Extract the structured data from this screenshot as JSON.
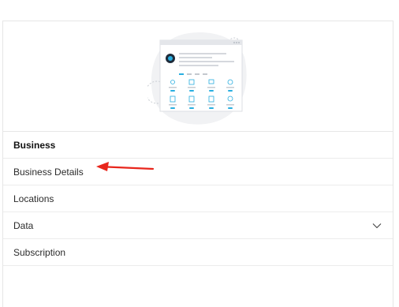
{
  "menu": {
    "header": "Business",
    "items": [
      {
        "label": "Business Details"
      },
      {
        "label": "Locations"
      },
      {
        "label": "Data",
        "has_chevron": true
      },
      {
        "label": "Subscription"
      }
    ]
  },
  "colors": {
    "accent": "#29aee0",
    "annotation_arrow": "#e8261c",
    "divider": "#e6e6e6"
  },
  "icons": {
    "chevron": "chevron-down-icon",
    "illustration": "dashboard-illustration"
  }
}
